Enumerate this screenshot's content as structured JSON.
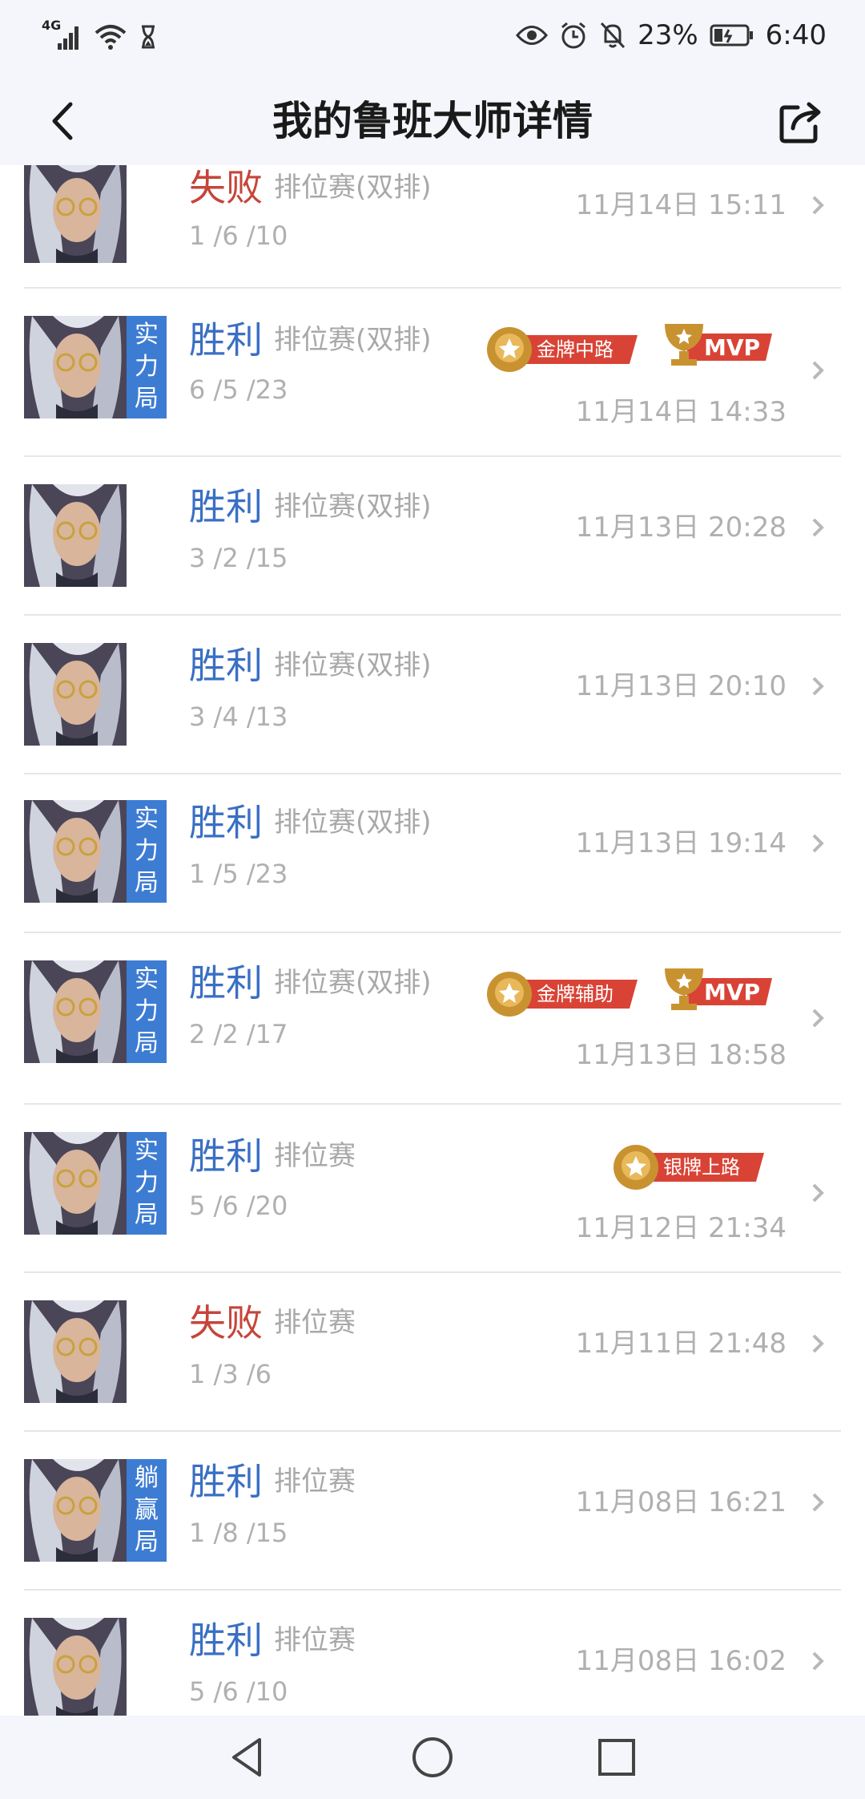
{
  "status_bar": {
    "network": "4G",
    "battery_percent": "23%",
    "time": "6:40",
    "icons": [
      "signal-icon",
      "wifi-icon",
      "hourglass-icon",
      "eye-icon",
      "alarm-icon",
      "mute-icon",
      "battery-icon"
    ]
  },
  "header": {
    "title": "我的鲁班大师详情",
    "back_icon": "back-icon",
    "share_icon": "share-icon"
  },
  "matches": [
    {
      "result": "失败",
      "result_type": "lose",
      "mode": "排位赛(双排)",
      "kda": "1 /6 /10",
      "time": "11月14日 15:11",
      "tag": "",
      "badges": []
    },
    {
      "result": "胜利",
      "result_type": "win",
      "mode": "排位赛(双排)",
      "kda": "6 /5 /23",
      "time": "11月14日 14:33",
      "tag": "实力局",
      "badges": [
        "金牌中路",
        "MVP"
      ]
    },
    {
      "result": "胜利",
      "result_type": "win",
      "mode": "排位赛(双排)",
      "kda": "3 /2 /15",
      "time": "11月13日 20:28",
      "tag": "",
      "badges": []
    },
    {
      "result": "胜利",
      "result_type": "win",
      "mode": "排位赛(双排)",
      "kda": "3 /4 /13",
      "time": "11月13日 20:10",
      "tag": "",
      "badges": []
    },
    {
      "result": "胜利",
      "result_type": "win",
      "mode": "排位赛(双排)",
      "kda": "1 /5 /23",
      "time": "11月13日 19:14",
      "tag": "实力局",
      "badges": []
    },
    {
      "result": "胜利",
      "result_type": "win",
      "mode": "排位赛(双排)",
      "kda": "2 /2 /17",
      "time": "11月13日 18:58",
      "tag": "实力局",
      "badges": [
        "金牌辅助",
        "MVP"
      ]
    },
    {
      "result": "胜利",
      "result_type": "win",
      "mode": "排位赛",
      "kda": "5 /6 /20",
      "time": "11月12日 21:34",
      "tag": "实力局",
      "badges": [
        "银牌上路"
      ]
    },
    {
      "result": "失败",
      "result_type": "lose",
      "mode": "排位赛",
      "kda": "1 /3 /6",
      "time": "11月11日 21:48",
      "tag": "",
      "badges": []
    },
    {
      "result": "胜利",
      "result_type": "win",
      "mode": "排位赛",
      "kda": "1 /8 /15",
      "time": "11月08日 16:21",
      "tag": "躺赢局",
      "badges": []
    },
    {
      "result": "胜利",
      "result_type": "win",
      "mode": "排位赛",
      "kda": "5 /6 /10",
      "time": "11月08日 16:02",
      "tag": "",
      "badges": []
    }
  ],
  "nav_bar": {
    "icons": [
      "nav-back-icon",
      "nav-home-icon",
      "nav-recents-icon"
    ]
  },
  "colors": {
    "win": "#3a6fc4",
    "lose": "#c5453a",
    "tag_bg": "#3d7cd3",
    "badge_red": "#d94336",
    "badge_gold": "#c99231"
  }
}
